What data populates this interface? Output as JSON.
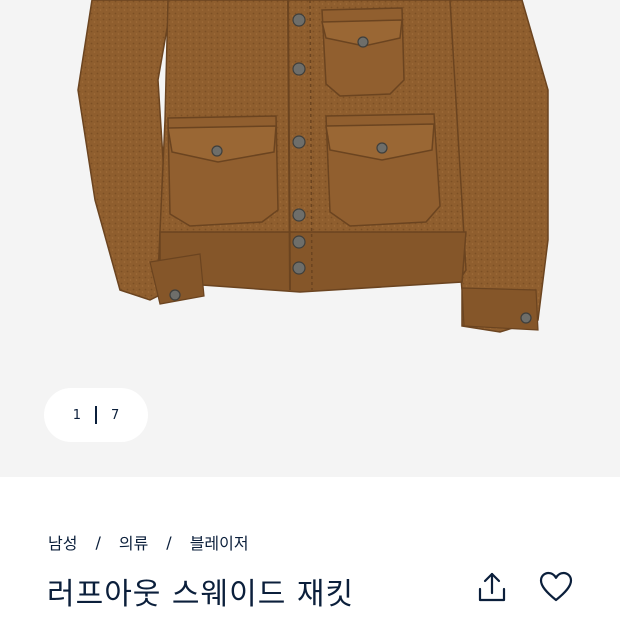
{
  "gallery": {
    "current_index": "1",
    "total": "7",
    "image_subject": "suede-trucker-jacket"
  },
  "breadcrumb": [
    "남성",
    "의류",
    "블레이저"
  ],
  "product": {
    "title": "러프아웃 스웨이드 재킷"
  },
  "icons": {
    "share": "share-upload-icon",
    "favorite": "heart-outline-icon"
  },
  "colors": {
    "navy": "#0b1f3b",
    "suede": "#8a5a2b",
    "background": "#f4f4f4"
  }
}
